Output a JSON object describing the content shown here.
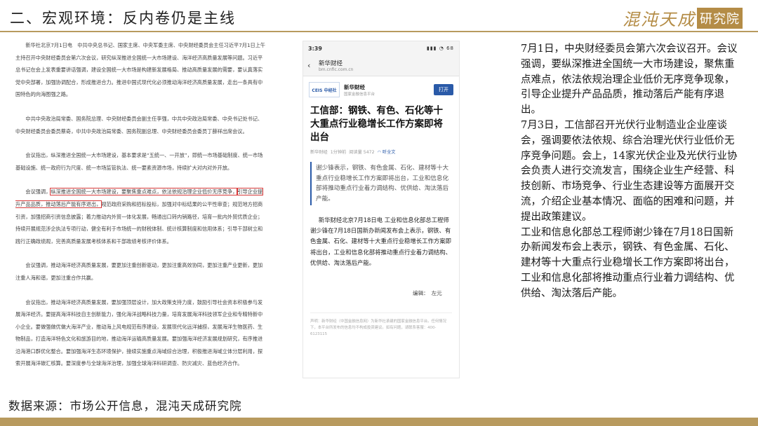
{
  "header": {
    "title": "二、宏观环境：反内卷仍是主线",
    "logo_text": "混沌天成",
    "logo_badge": "研究院"
  },
  "left_doc": {
    "paragraphs": [
      "新华社北京7月1日电　中共中央总书记、国家主席、中央军委主席、中央财经委员会主任习近平7月1日上午主持召开中央财经委员会第六次会议，研究纵深推进全国统一大市场建设、海洋经济高质量发展等问题。习近平总书记在会上发表重要讲话强调，建设全国统一大市场是构建新发展格局、推动高质量发展的需要，要认真落实党中央部署，加强协调配合，形成推进合力。推进中国式现代化必须推动海洋经济高质量发展，走出一条具有中国特色的向海图强之路。",
      "中共中央政治局常委、国务院总理、中央财经委员会副主任李强，中共中央政治局常委、中央书记处书记、中央财经委员会委员蔡奇，中共中央政治局常委、国务院副总理、中央财经委员会委员丁薛祥出席会议。",
      "会议指出，纵深推进全国统一大市场建设，基本要求是“五统一、一开放”，即统一市场基础制度、统一市场基础设施、统一政府行为尺度、统一市场监管执法、统一要素资源市场，持续扩大对内对外开放。"
    ],
    "p4_before": "会议强调，",
    "p4_highlight1": "纵深推进全国统一大市场建设，要聚焦重点难点，依法依规治理企业低价无序竞争，",
    "p4_highlight2": "引导企业提升产品品质，推动落后产能有序退出，",
    "p4_after": "规范政府采购和招标投标，加强对中标结果的公平性审查；规范地方招商引资，加强招商引资信息披露；着力推动内外贸一体化发展，畅通出口转内销路径，培育一批内外贸优质企业；持续开展规范涉企执法专项行动，健全有利于市场统一的财税体制、统计核算制度和信用体系；引导干部树立和践行正确政绩观，完善高质量发展考核体系和干部政绩考核评价体系。",
    "paragraphs_tail": [
      "会议强调，推动海洋经济高质量发展，要更加注重创新驱动，更加注重高效协同，更加注重产业更新，更加注重人海和谐，更加注重合作共赢。",
      "会议指出，推动海洋经济高质量发展，要加强顶层设计，加大政策支持力度，鼓励引导社会资本积极参与发展海洋经济。要提高海洋科技自主创新能力，强化海洋战略科技力量，培育发展海洋科技领军企业和专精特新中小企业。要做强做优做大海洋产业，推动海上风电规范有序建设，发展现代化远洋捕捞，发展海洋生物医药、生物制品，打造海洋特色文化和旅游目的地，推动海洋运输高质量发展。要加强海洋经济发展规划研究，有序推进沿海港口群优化整合。要加强海洋生态环境保护，接续实施重点海域综合治理，积极推进海域立体分层利用，探索开展海洋碳汇核算。要深度参与全球海洋治理，加强全球海洋科研调查、防灾减灾、蓝色经济合作。"
    ]
  },
  "phone": {
    "time": "3:39",
    "status_right": "▮▮▮ ◔ 68",
    "nav_back": "‹",
    "nav_title": "新华财经",
    "nav_url": "bm.cnfic.com.cn",
    "account_logo": "CEIS 中经社",
    "account_name": "新华财经",
    "account_sub": "国家金融信息平台",
    "open_label": "打开",
    "article_title": "工信部：钢铁、有色、石化等十大重点行业稳增长工作方案即将出台",
    "meta_source": "新华财经",
    "meta_time": "1分钟前",
    "meta_reads": "阅读量 5472",
    "meta_listen": "听全文",
    "summary": "谢少锋表示，钢铁、有色金属、石化、建材等十大重点行业稳增长工作方案即将出台，工业和信息化部将推动重点行业着力调结构、优供给、淘汰落后产能。",
    "body": "新华财经北京7月18日电 工业和信息化部总工程师谢少锋在7月18日国新办新闻发布会上表示，钢铁、有色金属、石化、建材等十大重点行业稳增长工作方案即将出台，工业和信息化部将推动重点行业着力调结构、优供给、淘汰落后产能。",
    "editor": "编辑：　左元",
    "footnote": "声明：新华财经（中国金融信息网）为新华社承建的国家金融信息平台。任何情况下，本平台所发布的信息均不构成投资建议。如有问题，请联系客服：400-6123115"
  },
  "right_paragraphs": [
    "7月1日，中央财经委员会第六次会议召开。会议强调，要纵深推进全国统一大市场建设，聚焦重点难点，依法依规治理企业低价无序竞争现象，引导企业提升产品品质，推动落后产能有序退出。",
    "7月3日，工信部召开光伏行业制造业企业座谈会，强调要依法依规、综合治理光伏行业低价无序竞争问题。会上，14家光伏企业及光伏行业协会负责人进行交流发言，围绕企业生产经营、科技创新、市场竞争、行业生态建设等方面展开交流，介绍企业基本情况、面临的困难和问题，并提出政策建议。",
    "工业和信息化部总工程师谢少锋在7月18日国新办新闻发布会上表示，钢铁、有色金属、石化、建材等十大重点行业稳增长工作方案即将出台，工业和信息化部将推动重点行业着力调结构、优供给、淘汰落后产能。"
  ],
  "footer": {
    "source": "数据来源：市场公开信息，混沌天成研究院"
  },
  "colors": {
    "gold": "#b89a5e",
    "highlight_box": "#d83a3a",
    "brand_blue": "#2a5aa8"
  }
}
